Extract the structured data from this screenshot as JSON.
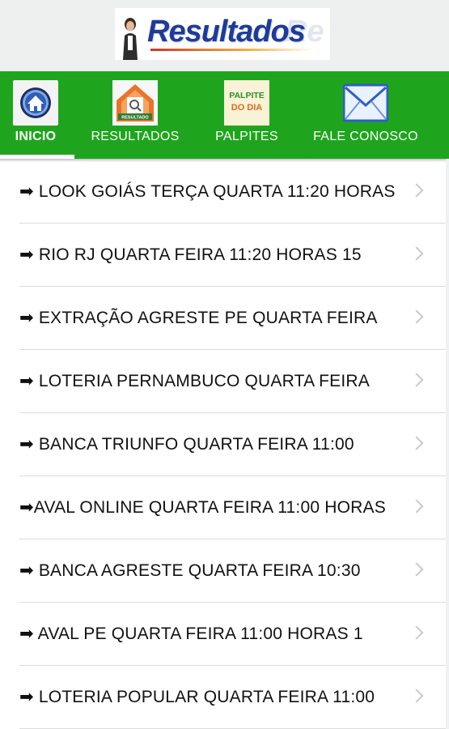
{
  "header": {
    "logo_text": "Resultados",
    "logo_ghost_text": "Re"
  },
  "nav": {
    "items": [
      {
        "label": "INICIO",
        "icon": "home-icon",
        "active": true
      },
      {
        "label": "RESULTADOS",
        "icon": "results-house-icon",
        "badge": "RESULTADO",
        "active": false
      },
      {
        "label": "PALPITES",
        "icon": "palpite-do-dia-icon",
        "icon_line1": "PALPITE",
        "icon_line2": "DO DIA",
        "active": false
      },
      {
        "label": "FALE CONOSCO",
        "icon": "mail-icon",
        "active": false
      }
    ],
    "accent_color": "#1fa51d"
  },
  "list": {
    "items": [
      "➡ LOOK GOIÁS TERÇA QUARTA 11:20 HORAS",
      "➡ RIO RJ QUARTA FEIRA 11:20 HORAS 15",
      "➡ EXTRAÇÃO AGRESTE PE QUARTA FEIRA",
      "➡ LOTERIA PERNAMBUCO QUARTA FEIRA",
      "➡ BANCA TRIUNFO QUARTA FEIRA 11:00",
      "➡AVAL ONLINE QUARTA FEIRA 11:00 HORAS",
      "➡ BANCA AGRESTE QUARTA FEIRA 10:30",
      "➡ AVAL PE QUARTA FEIRA 11:00 HORAS 1",
      "➡ LOTERIA POPULAR QUARTA FEIRA 11:00"
    ]
  }
}
